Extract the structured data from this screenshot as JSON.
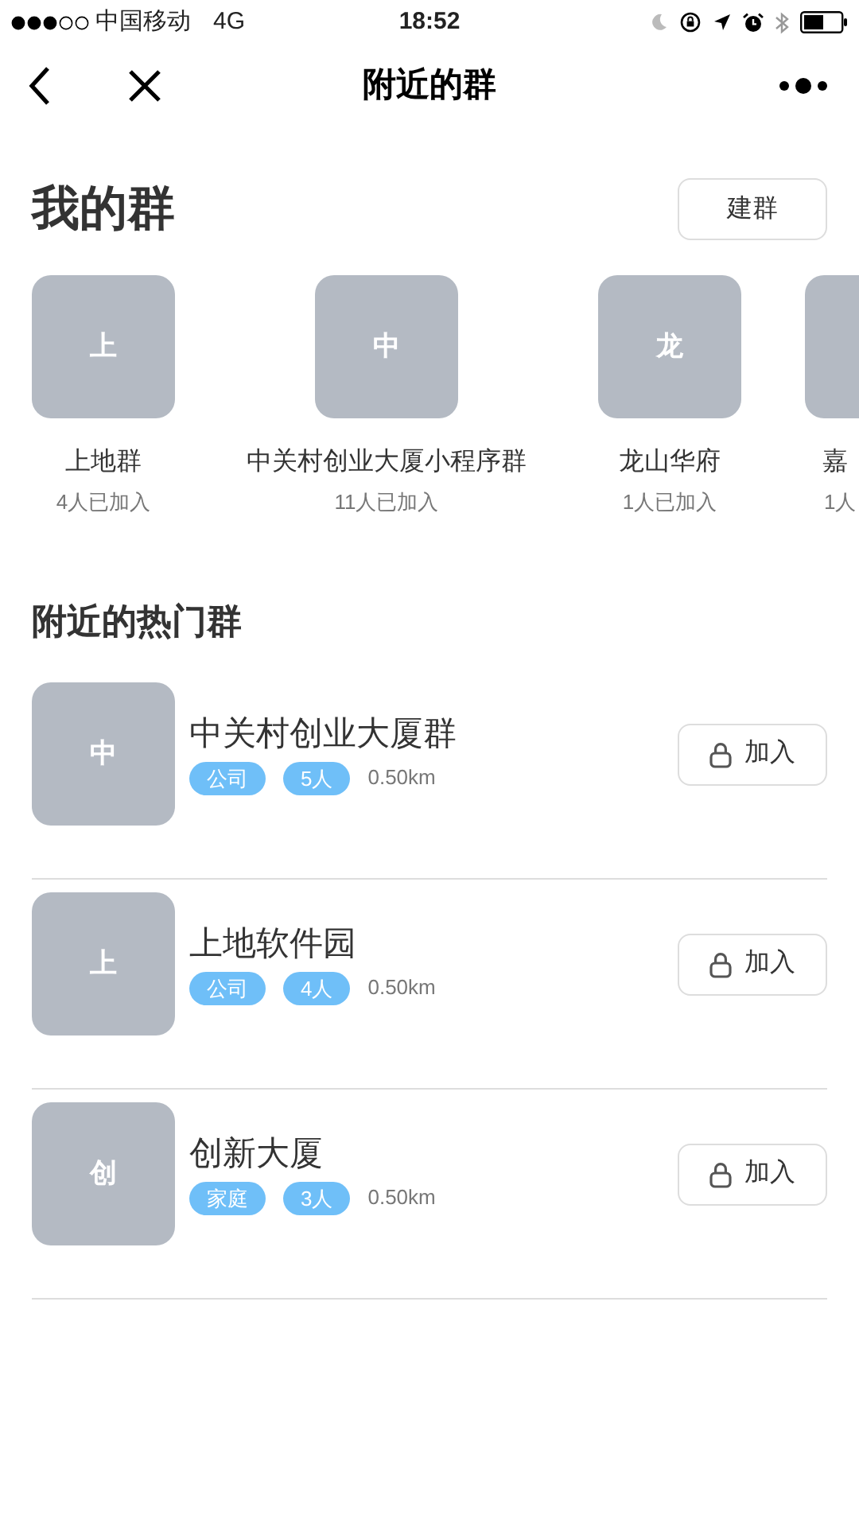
{
  "status_bar": {
    "carrier": "中国移动",
    "network": "4G",
    "time": "18:52"
  },
  "nav": {
    "title": "附近的群"
  },
  "my_groups": {
    "title": "我的群",
    "create_button": "建群",
    "items": [
      {
        "avatar": "上",
        "name": "上地群",
        "members": "4人已加入"
      },
      {
        "avatar": "中",
        "name": "中关村创业大厦小程序群",
        "members": "11人已加入"
      },
      {
        "avatar": "龙",
        "name": "龙山华府",
        "members": "1人已加入"
      },
      {
        "name": "嘉",
        "members": "1人"
      }
    ]
  },
  "nearby": {
    "title": "附近的热门群",
    "items": [
      {
        "avatar": "中",
        "name": "中关村创业大厦群",
        "tags": [
          "公司",
          "5人"
        ],
        "distance": "0.50km",
        "button": "加入"
      },
      {
        "avatar": "上",
        "name": "上地软件园",
        "tags": [
          "公司",
          "4人"
        ],
        "distance": "0.50km",
        "button": "加入"
      },
      {
        "avatar": "创",
        "name": "创新大厦",
        "tags": [
          "家庭",
          "3人"
        ],
        "distance": "0.50km",
        "button": "加入"
      }
    ]
  }
}
